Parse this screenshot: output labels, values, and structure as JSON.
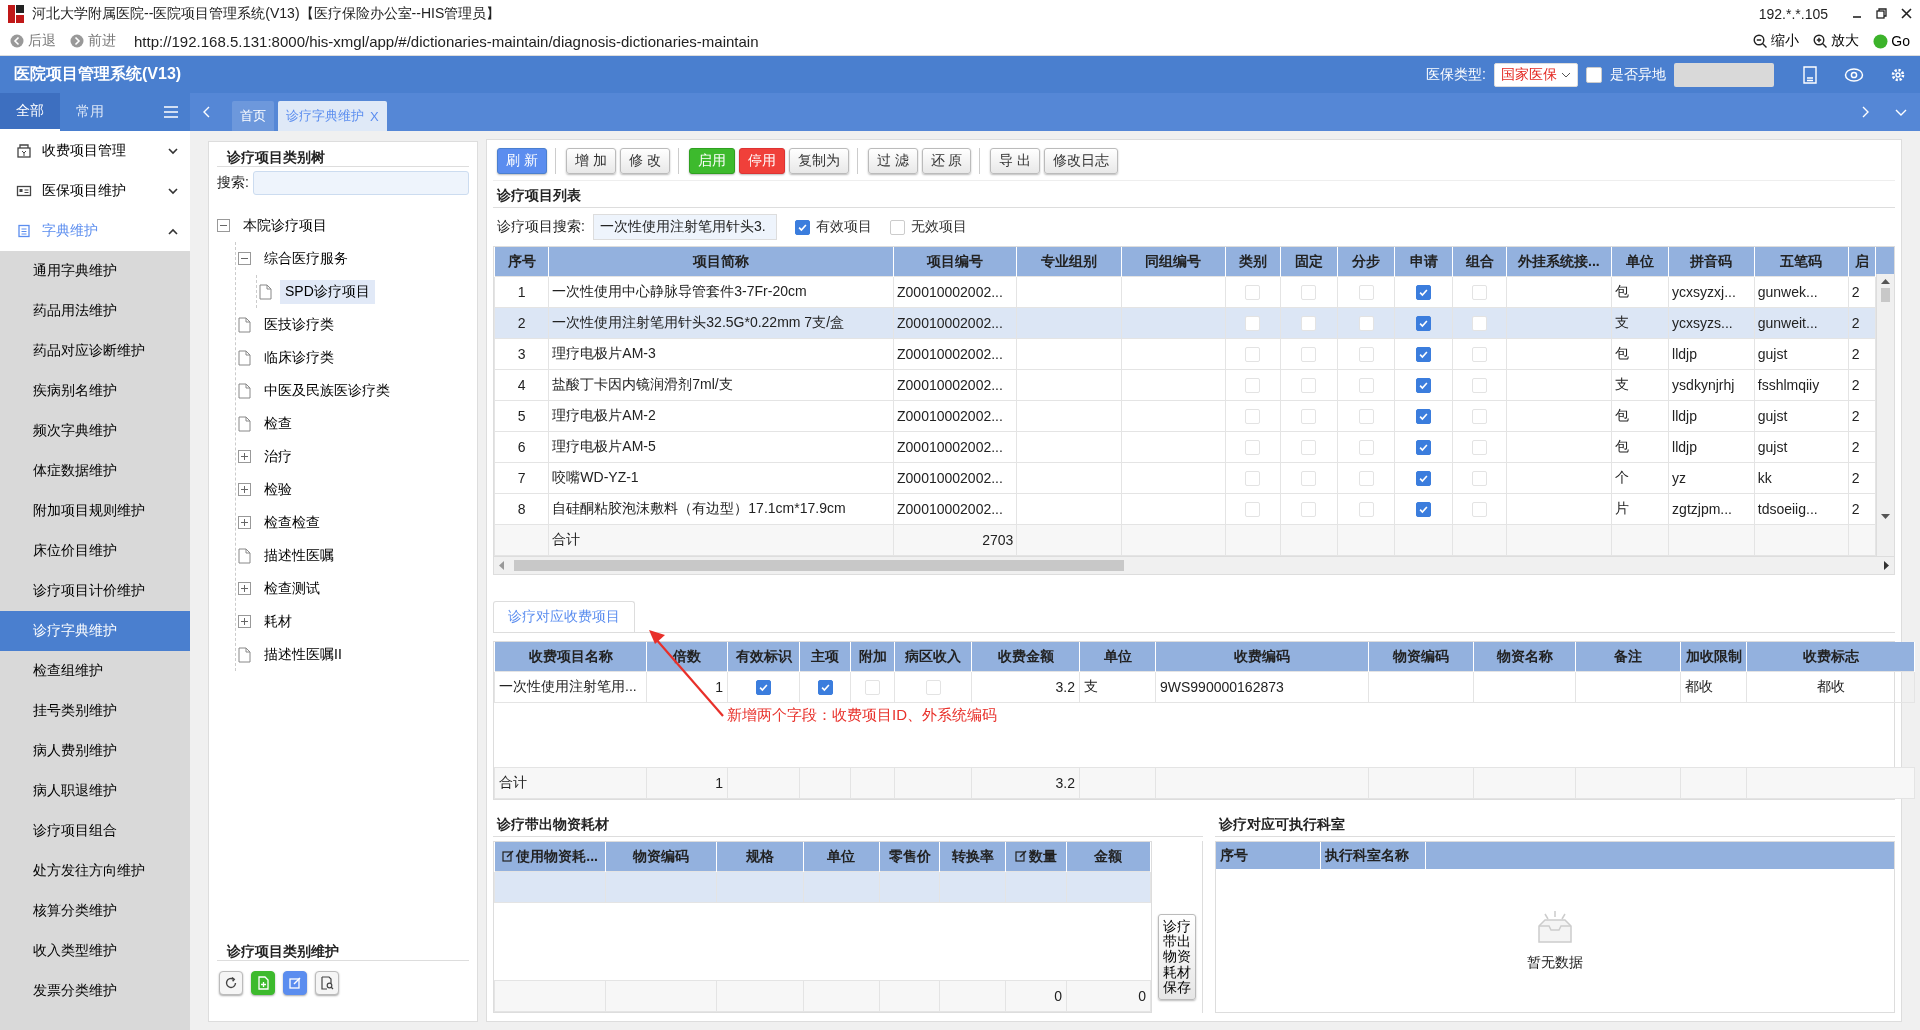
{
  "title_bar": {
    "title": "河北大学附属医院--医院项目管理系统(V13)【医疗保险办公室--HIS管理员】",
    "ip": "192.*.*.105"
  },
  "address_bar": {
    "back": "后退",
    "forward": "前进",
    "url": "http://192.168.5.131:8000/his-xmgl/app/#/dictionaries-maintain/diagnosis-dictionaries-maintain",
    "zoom_out": "缩小",
    "zoom_in": "放大",
    "go": "Go"
  },
  "header": {
    "app_title": "医院项目管理系统(V13)",
    "insurance_label": "医保类型:",
    "insurance_value": "国家医保",
    "remote_label": "是否异地",
    "remote_checked": false
  },
  "nav_tabs": [
    {
      "label": "全部",
      "selected": true
    },
    {
      "label": "常用",
      "selected": false
    }
  ],
  "page_tabs": [
    {
      "label": "首页",
      "selected": false
    },
    {
      "label": "诊疗字典维护",
      "selected": true,
      "close": "X"
    }
  ],
  "sidebar": [
    {
      "label": "收费项目管理",
      "kind": "charge",
      "expanded": false
    },
    {
      "label": "医保项目维护",
      "kind": "insurance",
      "expanded": false
    },
    {
      "label": "字典维护",
      "kind": "dictionary",
      "expanded": true,
      "children": [
        {
          "label": "通用字典维护",
          "selected": false
        },
        {
          "label": "药品用法维护",
          "selected": false
        },
        {
          "label": "药品对应诊断维护",
          "selected": false
        },
        {
          "label": "疾病别名维护",
          "selected": false
        },
        {
          "label": "频次字典维护",
          "selected": false
        },
        {
          "label": "体症数据维护",
          "selected": false
        },
        {
          "label": "附加项目规则维护",
          "selected": false
        },
        {
          "label": "床位价目维护",
          "selected": false
        },
        {
          "label": "诊疗项目计价维护",
          "selected": false
        },
        {
          "label": "诊疗字典维护",
          "selected": true
        },
        {
          "label": "检查组维护",
          "selected": false
        },
        {
          "label": "挂号类别维护",
          "selected": false
        },
        {
          "label": "病人费别维护",
          "selected": false
        },
        {
          "label": "病人职退维护",
          "selected": false
        },
        {
          "label": "诊疗项目组合",
          "selected": false
        },
        {
          "label": "处方发往方向维护",
          "selected": false
        },
        {
          "label": "核算分类维护",
          "selected": false
        },
        {
          "label": "收入类型维护",
          "selected": false
        },
        {
          "label": "发票分类维护",
          "selected": false
        }
      ]
    }
  ],
  "tree": {
    "title": "诊疗项目类别树",
    "search_label": "搜索:",
    "nodes": [
      {
        "label": "本院诊疗项目",
        "kind": "folder",
        "expanded": true,
        "selected": false,
        "children": [
          {
            "label": "综合医疗服务",
            "kind": "folder",
            "expanded": true,
            "selected": false,
            "children": [
              {
                "label": "SPD诊疗项目",
                "kind": "file",
                "selected": true
              }
            ]
          },
          {
            "label": "医技诊疗类",
            "kind": "file",
            "selected": false
          },
          {
            "label": "临床诊疗类",
            "kind": "file",
            "selected": false
          },
          {
            "label": "中医及民族医诊疗类",
            "kind": "file",
            "selected": false
          },
          {
            "label": "检查",
            "kind": "file",
            "selected": false
          },
          {
            "label": "治疗",
            "kind": "folder",
            "expanded": false,
            "selected": false
          },
          {
            "label": "检验",
            "kind": "folder",
            "expanded": false,
            "selected": false
          },
          {
            "label": "检查检查",
            "kind": "folder",
            "expanded": false,
            "selected": false
          },
          {
            "label": "描述性医嘱",
            "kind": "file",
            "selected": false
          },
          {
            "label": "检查测试",
            "kind": "folder",
            "expanded": false,
            "selected": false
          },
          {
            "label": "耗材",
            "kind": "folder",
            "expanded": false,
            "selected": false
          },
          {
            "label": "描述性医嘱II",
            "kind": "file",
            "selected": false
          }
        ]
      }
    ]
  },
  "tree_maintenance": {
    "title": "诊疗项目类别维护",
    "buttons": [
      {
        "kind": "refresh"
      },
      {
        "kind": "add"
      },
      {
        "kind": "edit"
      },
      {
        "kind": "preview"
      }
    ]
  },
  "toolbar": [
    [
      {
        "label": "刷 新",
        "kind": "primary"
      }
    ],
    [
      {
        "label": "增 加",
        "kind": "default"
      },
      {
        "label": "修 改",
        "kind": "default"
      }
    ],
    [
      {
        "label": "启用",
        "kind": "success"
      },
      {
        "label": "停用",
        "kind": "danger"
      },
      {
        "label": "复制为",
        "kind": "default"
      }
    ],
    [
      {
        "label": "过 滤",
        "kind": "default"
      },
      {
        "label": "还 原",
        "kind": "default"
      }
    ],
    [
      {
        "label": "导 出",
        "kind": "default"
      },
      {
        "label": "修改日志",
        "kind": "default"
      }
    ]
  ],
  "item_list": {
    "title": "诊疗项目列表",
    "search_label": "诊疗项目搜索:",
    "search_value": "一次性使用注射笔用针头3.",
    "valid_label": "有效项目",
    "valid_checked": true,
    "invalid_label": "无效项目",
    "invalid_checked": false,
    "columns": [
      "序号",
      "项目简称",
      "项目编号",
      "专业组别",
      "同组编号",
      "类别",
      "固定",
      "分步",
      "申请",
      "组合",
      "外挂系统接...",
      "单位",
      "拼音码",
      "五笔码",
      "启"
    ],
    "rows": [
      {
        "no": "1",
        "name": "一次性使用中心静脉导管套件3-7Fr-20cm",
        "code": "Z00010002002...",
        "category": false,
        "fixed": false,
        "step": false,
        "apply": true,
        "combo": false,
        "unit": "包",
        "pinyin": "ycxsyzxj...",
        "wubi": "gunwek...",
        "column_15": "2",
        "selected": false
      },
      {
        "no": "2",
        "name": "一次性使用注射笔用针头32.5G*0.22mm 7支/盒",
        "code": "Z00010002002...",
        "category": false,
        "fixed": false,
        "step": false,
        "apply": true,
        "combo": false,
        "unit": "支",
        "pinyin": "ycxsyzs...",
        "wubi": "gunweit...",
        "column_15": "2",
        "selected": true
      },
      {
        "no": "3",
        "name": "理疗电极片AM-3",
        "code": "Z00010002002...",
        "category": false,
        "fixed": false,
        "step": false,
        "apply": true,
        "combo": false,
        "unit": "包",
        "pinyin": "lldjp",
        "wubi": "gujst",
        "column_15": "2",
        "selected": false
      },
      {
        "no": "4",
        "name": "盐酸丁卡因内镜润滑剂7ml/支",
        "code": "Z00010002002...",
        "category": false,
        "fixed": false,
        "step": false,
        "apply": true,
        "combo": false,
        "unit": "支",
        "pinyin": "ysdkynjrhj",
        "wubi": "fsshlmqiiy",
        "column_15": "2",
        "selected": false
      },
      {
        "no": "5",
        "name": "理疗电极片AM-2",
        "code": "Z00010002002...",
        "category": false,
        "fixed": false,
        "step": false,
        "apply": true,
        "combo": false,
        "unit": "包",
        "pinyin": "lldjp",
        "wubi": "gujst",
        "column_15": "2",
        "selected": false
      },
      {
        "no": "6",
        "name": "理疗电极片AM-5",
        "code": "Z00010002002...",
        "category": false,
        "fixed": false,
        "step": false,
        "apply": true,
        "combo": false,
        "unit": "包",
        "pinyin": "lldjp",
        "wubi": "gujst",
        "column_15": "2",
        "selected": false
      },
      {
        "no": "7",
        "name": "咬嘴WD-YZ-1",
        "code": "Z00010002002...",
        "category": false,
        "fixed": false,
        "step": false,
        "apply": true,
        "combo": false,
        "unit": "个",
        "pinyin": "yz",
        "wubi": "kk",
        "column_15": "2",
        "selected": false
      },
      {
        "no": "8",
        "name": "自硅酮粘胶泡沫敷料（有边型）17.1cm*17.9cm",
        "code": "Z00010002002...",
        "category": false,
        "fixed": false,
        "step": false,
        "apply": true,
        "combo": false,
        "unit": "片",
        "pinyin": "zgtzjpm...",
        "wubi": "tdsoeiig...",
        "column_15": "2",
        "selected": false
      }
    ],
    "total": {
      "label": "合计",
      "count": "2703"
    }
  },
  "fee_tab": {
    "label": "诊疗对应收费项目",
    "selected": true
  },
  "fee_table": {
    "columns": [
      "收费项目名称",
      "倍数",
      "有效标识",
      "主项",
      "附加",
      "病区收入",
      "收费金额",
      "单位",
      "收费编码",
      "物资编码",
      "物资名称",
      "备注",
      "加收限制",
      "收费标志"
    ],
    "rows": [
      {
        "name": "一次性使用注射笔用...",
        "multiple": "1",
        "valid": true,
        "main": true,
        "extra": false,
        "ward_income": false,
        "amount": "3.2",
        "unit": "支",
        "fee_code": "9WS990000162873",
        "limit": "都收",
        "flag": "都收"
      }
    ],
    "total": {
      "label": "合计",
      "multiple": "1",
      "amount": "3.2"
    }
  },
  "annotation": {
    "text": "新增两个字段：收费项目ID、外系统编码"
  },
  "materials": {
    "title": "诊疗带出物资耗材",
    "columns": [
      {
        "label": "使用物资耗...",
        "editable": true
      },
      {
        "label": "物资编码",
        "editable": false
      },
      {
        "label": "规格",
        "editable": false
      },
      {
        "label": "单位",
        "editable": false
      },
      {
        "label": "零售价",
        "editable": false
      },
      {
        "label": "转换率",
        "editable": false
      },
      {
        "label": "数量",
        "editable": true
      },
      {
        "label": "金额",
        "editable": false
      }
    ],
    "totals": [
      "0",
      "0"
    ],
    "save_button": "诊疗带出物资耗材保存"
  },
  "departments": {
    "title": "诊疗对应可执行科室",
    "columns": [
      "序号",
      "执行科室名称"
    ],
    "empty_text": "暂无数据"
  }
}
